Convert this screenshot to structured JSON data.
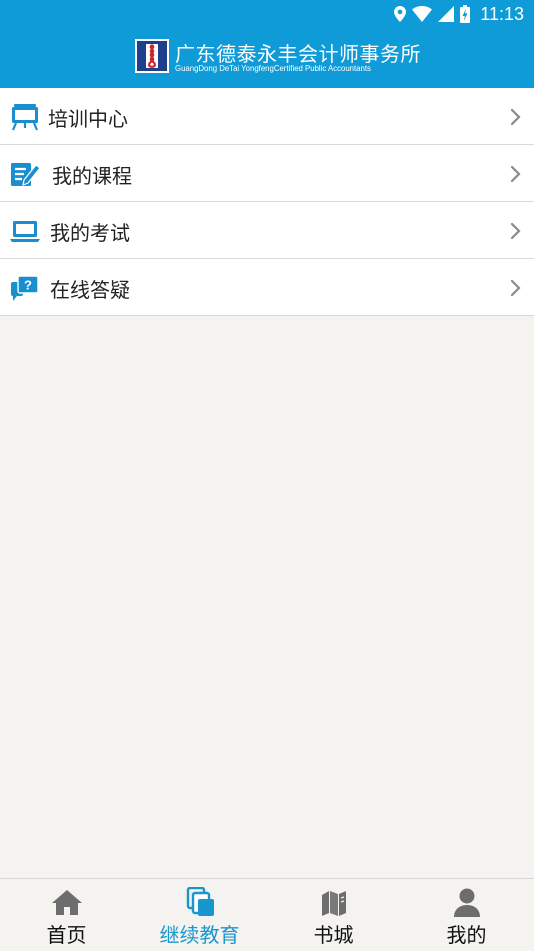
{
  "status_bar": {
    "time": "11:13",
    "icons": [
      "location-icon",
      "wifi-icon",
      "signal-icon",
      "battery-icon"
    ]
  },
  "header": {
    "title_cn": "广东德泰永丰会计师事务所",
    "title_en": "GuangDong DeTai YongfengCertified Public Accountants",
    "logo": "firm-logo"
  },
  "menu": {
    "items": [
      {
        "label": "培训中心",
        "icon": "training-board-icon"
      },
      {
        "label": "我的课程",
        "icon": "edit-course-icon"
      },
      {
        "label": "我的考试",
        "icon": "laptop-exam-icon"
      },
      {
        "label": "在线答疑",
        "icon": "question-chat-icon"
      }
    ]
  },
  "tabbar": {
    "active": "继续教育",
    "tabs": [
      {
        "label": "首页",
        "icon": "home-icon"
      },
      {
        "label": "继续教育",
        "icon": "education-icon"
      },
      {
        "label": "书城",
        "icon": "books-icon"
      },
      {
        "label": "我的",
        "icon": "user-icon"
      }
    ]
  },
  "colors": {
    "brand_blue": "#0e9bd7",
    "active_tab": "#1a96cf",
    "background": "#f4f3f0",
    "icon_gray": "#6d6d6d"
  }
}
